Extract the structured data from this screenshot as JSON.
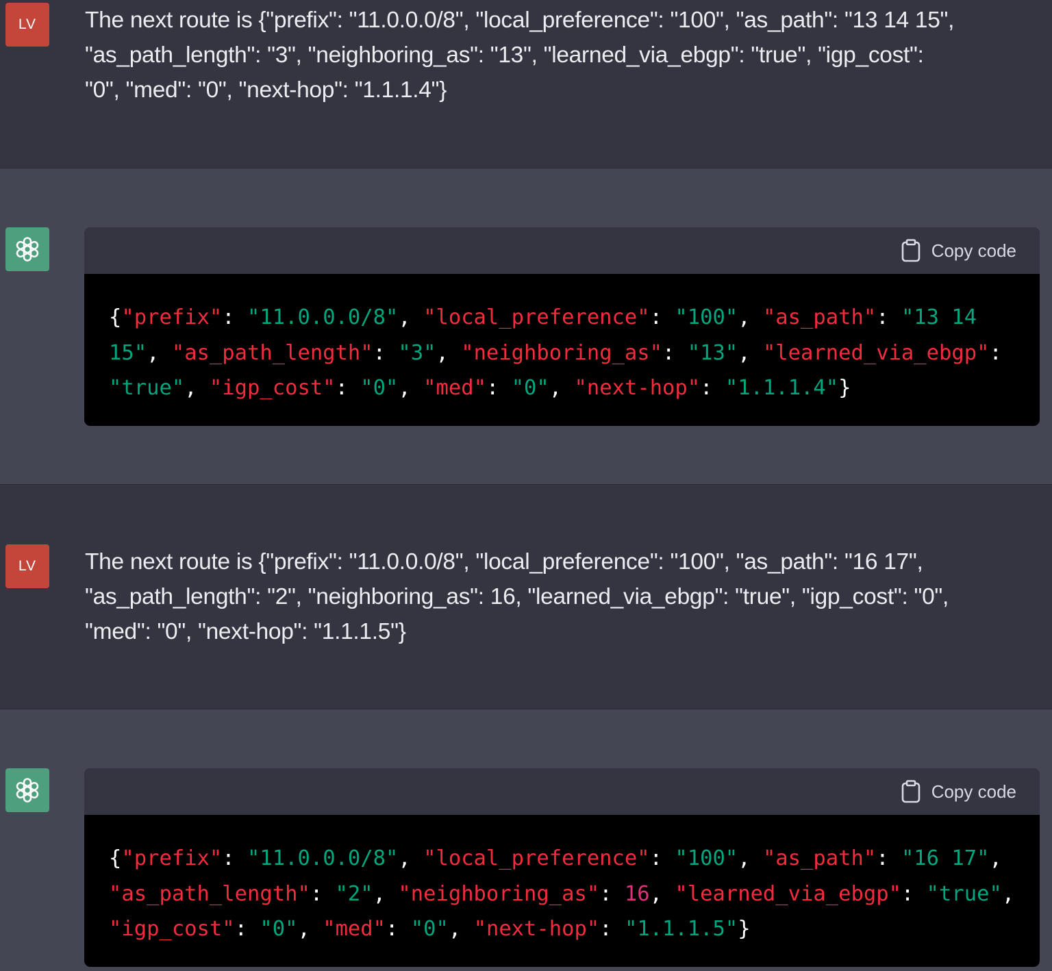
{
  "colors": {
    "background_user": "#343541",
    "background_assistant": "#444654",
    "user_avatar": "#c4453a",
    "assistant_avatar": "#4d9f7e",
    "code_key": "#f22c3d",
    "code_string": "#00a67d",
    "code_number": "#df3079"
  },
  "icons": {
    "assistant_avatar": "openai-logo-icon",
    "copy": "clipboard-icon"
  },
  "messages": [
    {
      "role": "user",
      "avatar_label": "LV",
      "lines": [
        "The next route is {\"prefix\": \"11.0.0.0/8\", \"local_preference\": \"100\", \"as_path\": \"13 14 15\",",
        "\"as_path_length\": \"3\", \"neighboring_as\": \"13\", \"learned_via_ebgp\": \"true\", \"igp_cost\":",
        "\"0\", \"med\": \"0\", \"next-hop\": \"1.1.1.4\"}"
      ]
    },
    {
      "role": "assistant",
      "copy_label": "Copy code",
      "code_lines": [
        [
          [
            "p",
            "{"
          ],
          [
            "k",
            "\"prefix\""
          ],
          [
            "p",
            ": "
          ],
          [
            "s",
            "\"11.0.0.0/8\""
          ],
          [
            "p",
            ", "
          ],
          [
            "k",
            "\"local_preference\""
          ],
          [
            "p",
            ": "
          ],
          [
            "s",
            "\"100\""
          ],
          [
            "p",
            ", "
          ],
          [
            "k",
            "\"as_path\""
          ],
          [
            "p",
            ": "
          ],
          [
            "s",
            "\"13 14"
          ]
        ],
        [
          [
            "s",
            "15\""
          ],
          [
            "p",
            ", "
          ],
          [
            "k",
            "\"as_path_length\""
          ],
          [
            "p",
            ": "
          ],
          [
            "s",
            "\"3\""
          ],
          [
            "p",
            ", "
          ],
          [
            "k",
            "\"neighboring_as\""
          ],
          [
            "p",
            ": "
          ],
          [
            "s",
            "\"13\""
          ],
          [
            "p",
            ", "
          ],
          [
            "k",
            "\"learned_via_ebgp\""
          ],
          [
            "p",
            ":"
          ]
        ],
        [
          [
            "s",
            "\"true\""
          ],
          [
            "p",
            ", "
          ],
          [
            "k",
            "\"igp_cost\""
          ],
          [
            "p",
            ": "
          ],
          [
            "s",
            "\"0\""
          ],
          [
            "p",
            ", "
          ],
          [
            "k",
            "\"med\""
          ],
          [
            "p",
            ": "
          ],
          [
            "s",
            "\"0\""
          ],
          [
            "p",
            ", "
          ],
          [
            "k",
            "\"next-hop\""
          ],
          [
            "p",
            ": "
          ],
          [
            "s",
            "\"1.1.1.4\""
          ],
          [
            "p",
            "}"
          ]
        ]
      ]
    },
    {
      "role": "user",
      "avatar_label": "LV",
      "lines": [
        "The next route is {\"prefix\": \"11.0.0.0/8\", \"local_preference\": \"100\", \"as_path\": \"16 17\",",
        "\"as_path_length\": \"2\", \"neighboring_as\": 16, \"learned_via_ebgp\": \"true\", \"igp_cost\": \"0\",",
        "\"med\": \"0\", \"next-hop\": \"1.1.1.5\"}"
      ]
    },
    {
      "role": "assistant",
      "copy_label": "Copy code",
      "code_lines": [
        [
          [
            "p",
            "{"
          ],
          [
            "k",
            "\"prefix\""
          ],
          [
            "p",
            ": "
          ],
          [
            "s",
            "\"11.0.0.0/8\""
          ],
          [
            "p",
            ", "
          ],
          [
            "k",
            "\"local_preference\""
          ],
          [
            "p",
            ": "
          ],
          [
            "s",
            "\"100\""
          ],
          [
            "p",
            ", "
          ],
          [
            "k",
            "\"as_path\""
          ],
          [
            "p",
            ": "
          ],
          [
            "s",
            "\"16 17\""
          ],
          [
            "p",
            ","
          ]
        ],
        [
          [
            "k",
            "\"as_path_length\""
          ],
          [
            "p",
            ": "
          ],
          [
            "s",
            "\"2\""
          ],
          [
            "p",
            ", "
          ],
          [
            "k",
            "\"neighboring_as\""
          ],
          [
            "p",
            ": "
          ],
          [
            "n",
            "16"
          ],
          [
            "p",
            ", "
          ],
          [
            "k",
            "\"learned_via_ebgp\""
          ],
          [
            "p",
            ": "
          ],
          [
            "s",
            "\"true\""
          ],
          [
            "p",
            ","
          ]
        ],
        [
          [
            "k",
            "\"igp_cost\""
          ],
          [
            "p",
            ": "
          ],
          [
            "s",
            "\"0\""
          ],
          [
            "p",
            ", "
          ],
          [
            "k",
            "\"med\""
          ],
          [
            "p",
            ": "
          ],
          [
            "s",
            "\"0\""
          ],
          [
            "p",
            ", "
          ],
          [
            "k",
            "\"next-hop\""
          ],
          [
            "p",
            ": "
          ],
          [
            "s",
            "\"1.1.1.5\""
          ],
          [
            "p",
            "}"
          ]
        ]
      ]
    }
  ]
}
